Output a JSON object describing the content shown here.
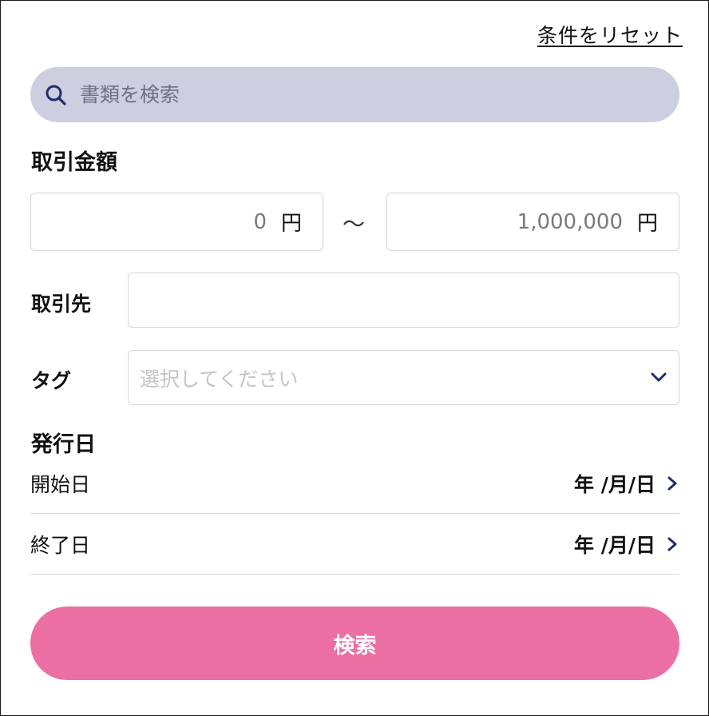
{
  "reset_label": "条件をリセット",
  "search": {
    "placeholder": "書類を検索"
  },
  "amount": {
    "title": "取引金額",
    "min_value": "0",
    "max_value": "1,000,000",
    "unit": "円",
    "separator": "〜"
  },
  "partner": {
    "label": "取引先",
    "value": ""
  },
  "tag": {
    "label": "タグ",
    "placeholder": "選択してください"
  },
  "issue_date": {
    "title": "発行日",
    "start": {
      "label": "開始日",
      "value": "年 /月/日"
    },
    "end": {
      "label": "終了日",
      "value": "年 /月/日"
    }
  },
  "submit_label": "検索",
  "colors": {
    "search_bg": "#cdcfe0",
    "icon_navy": "#1f2d6b",
    "submit_bg": "#ec6fa4",
    "border": "#d6d6d6"
  }
}
